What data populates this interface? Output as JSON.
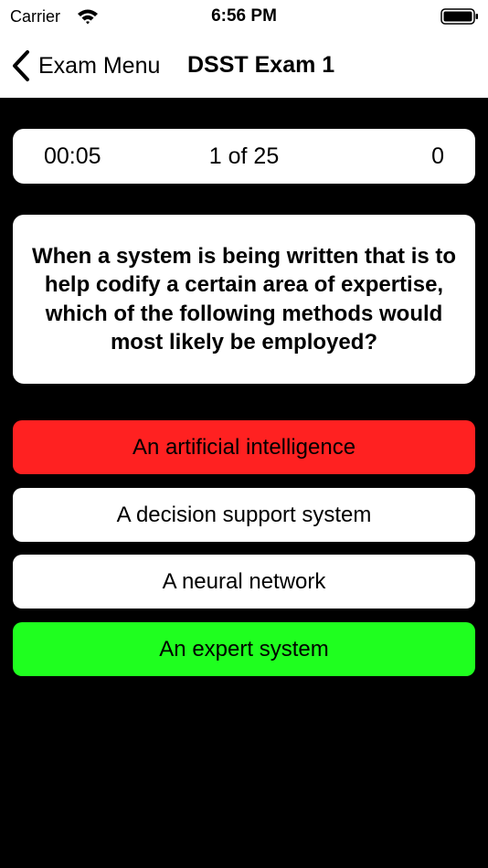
{
  "status_bar": {
    "carrier": "Carrier",
    "time": "6:56 PM",
    "wifi_icon": "wifi-icon",
    "battery_icon": "battery-icon"
  },
  "nav": {
    "back_label": "Exam Menu",
    "back_icon": "chevron-left-icon",
    "title": "DSST Exam 1"
  },
  "stats": {
    "timer": "00:05",
    "progress": "1 of 25",
    "score": "0"
  },
  "question": {
    "text": "When a system is being written that is to help codify a certain area of expertise, which of the following methods would most likely be employed?"
  },
  "answers": [
    {
      "label": "An artificial intelligence",
      "state": "incorrect",
      "color": "#ff2121"
    },
    {
      "label": "A decision support system",
      "state": "neutral",
      "color": "#ffffff"
    },
    {
      "label": "A neural network",
      "state": "neutral",
      "color": "#ffffff"
    },
    {
      "label": "An expert system",
      "state": "correct",
      "color": "#1fff1f"
    }
  ],
  "colors": {
    "background": "#000000",
    "card": "#ffffff",
    "incorrect": "#ff2121",
    "correct": "#1fff1f"
  }
}
